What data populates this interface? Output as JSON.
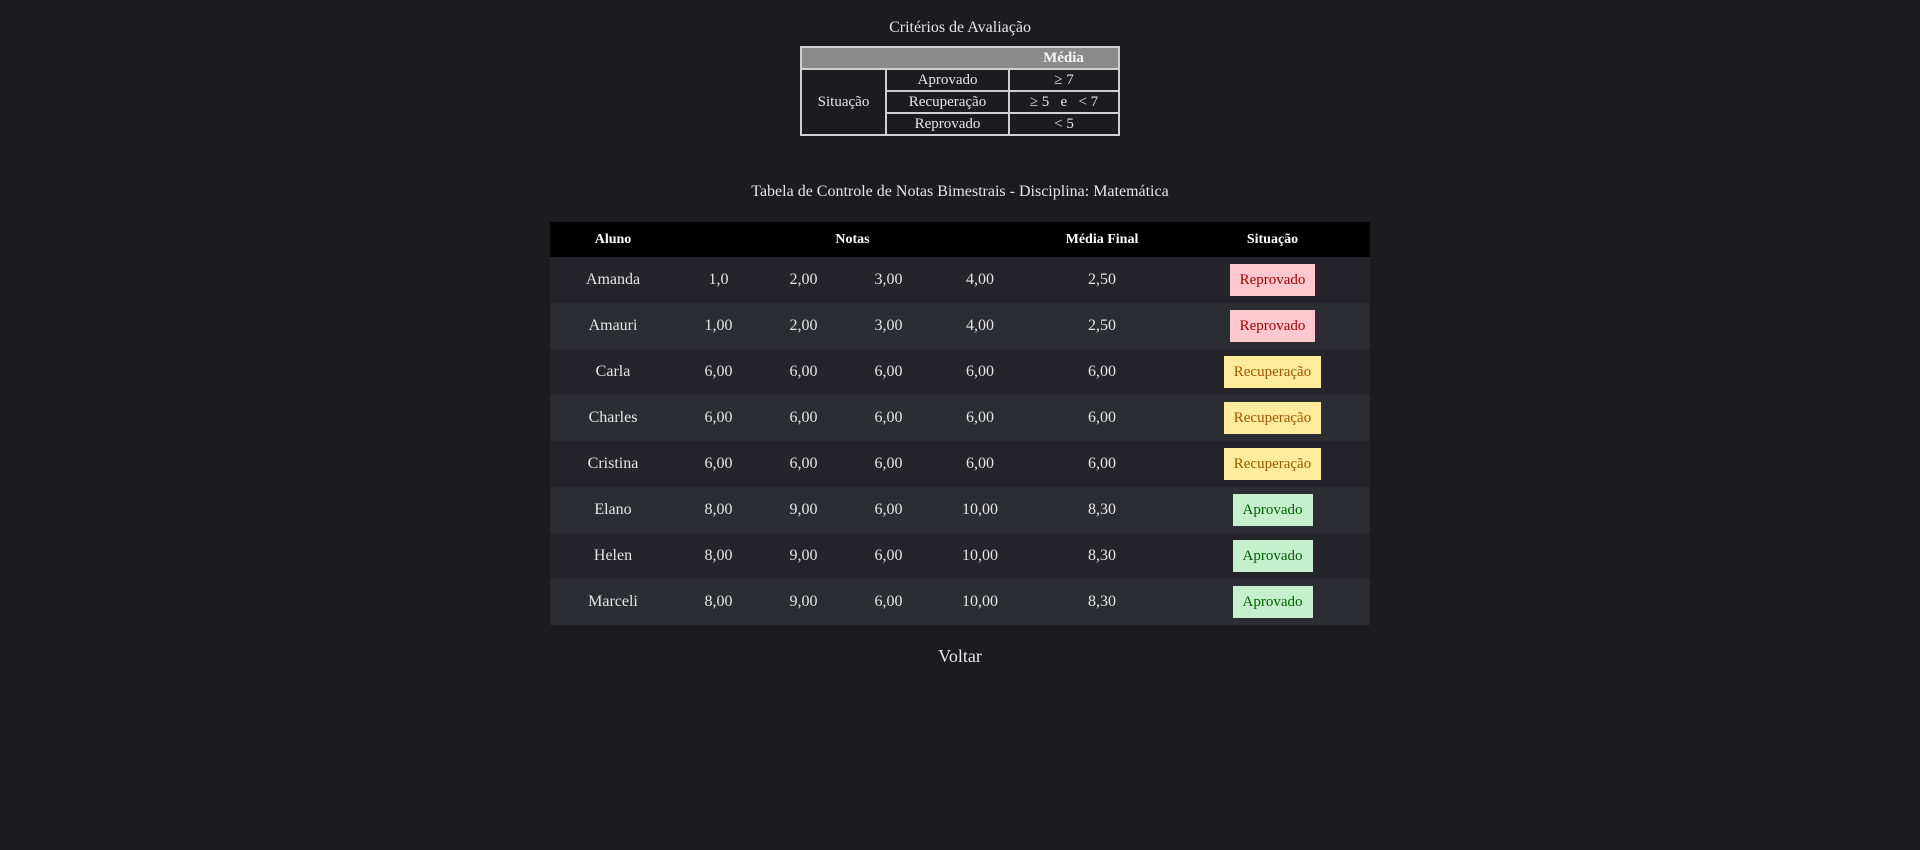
{
  "criteria": {
    "caption": "Critérios de Avaliação",
    "header": "Média",
    "row_label": "Situação",
    "rows": [
      {
        "label": "Aprovado",
        "rule": "≥ 7"
      },
      {
        "label": "Recuperação",
        "rule": "≥ 5   e   < 7"
      },
      {
        "label": "Reprovado",
        "rule": "< 5"
      }
    ]
  },
  "grades": {
    "caption": "Tabela de Controle de Notas Bimestrais - Disciplina: Matemática",
    "headers": {
      "aluno": "Aluno",
      "notas": "Notas",
      "media": "Média Final",
      "situacao": "Situação"
    },
    "rows": [
      {
        "aluno": "Amanda",
        "n1": "1,0",
        "n2": "2,00",
        "n3": "3,00",
        "n4": "4,00",
        "media": "2,50",
        "situacao": "Reprovado",
        "status": "reprovado"
      },
      {
        "aluno": "Amauri",
        "n1": "1,00",
        "n2": "2,00",
        "n3": "3,00",
        "n4": "4,00",
        "media": "2,50",
        "situacao": "Reprovado",
        "status": "reprovado"
      },
      {
        "aluno": "Carla",
        "n1": "6,00",
        "n2": "6,00",
        "n3": "6,00",
        "n4": "6,00",
        "media": "6,00",
        "situacao": "Recuperação",
        "status": "recuperacao"
      },
      {
        "aluno": "Charles",
        "n1": "6,00",
        "n2": "6,00",
        "n3": "6,00",
        "n4": "6,00",
        "media": "6,00",
        "situacao": "Recuperação",
        "status": "recuperacao"
      },
      {
        "aluno": "Cristina",
        "n1": "6,00",
        "n2": "6,00",
        "n3": "6,00",
        "n4": "6,00",
        "media": "6,00",
        "situacao": "Recuperação",
        "status": "recuperacao"
      },
      {
        "aluno": "Elano",
        "n1": "8,00",
        "n2": "9,00",
        "n3": "6,00",
        "n4": "10,00",
        "media": "8,30",
        "situacao": "Aprovado",
        "status": "aprovado"
      },
      {
        "aluno": "Helen",
        "n1": "8,00",
        "n2": "9,00",
        "n3": "6,00",
        "n4": "10,00",
        "media": "8,30",
        "situacao": "Aprovado",
        "status": "aprovado"
      },
      {
        "aluno": "Marceli",
        "n1": "8,00",
        "n2": "9,00",
        "n3": "6,00",
        "n4": "10,00",
        "media": "8,30",
        "situacao": "Aprovado",
        "status": "aprovado"
      }
    ]
  },
  "footer": {
    "back_label": "Voltar"
  },
  "colors": {
    "background": "#1b1b20",
    "reprovado_bg": "#ffc7ce",
    "recuperacao_bg": "#ffeb9c",
    "aprovado_bg": "#c6efce"
  }
}
